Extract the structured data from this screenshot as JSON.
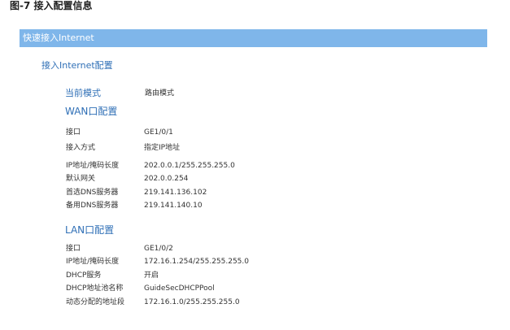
{
  "caption": "图-7 接入配置信息",
  "banner": {
    "title": "快速接入Internet"
  },
  "section": {
    "title": "接入Internet配置"
  },
  "mode": {
    "label": "当前模式",
    "value": "路由模式"
  },
  "wan": {
    "title": "WAN口配置",
    "rows": [
      {
        "label": "接口",
        "value": "GE1/0/1"
      },
      {
        "label": "接入方式",
        "value": "指定IP地址"
      },
      {
        "label": "IP地址/掩码长度",
        "value": "202.0.0.1/255.255.255.0"
      },
      {
        "label": "默认网关",
        "value": "202.0.0.254"
      },
      {
        "label": "首选DNS服务器",
        "value": "219.141.136.102"
      },
      {
        "label": "备用DNS服务器",
        "value": "219.141.140.10"
      }
    ]
  },
  "lan": {
    "title": "LAN口配置",
    "rows": [
      {
        "label": "接口",
        "value": "GE1/0/2"
      },
      {
        "label": "IP地址/掩码长度",
        "value": "172.16.1.254/255.255.255.0"
      },
      {
        "label": "DHCP服务",
        "value": "开启"
      },
      {
        "label": "DHCP地址池名称",
        "value": "GuideSecDHCPPool"
      },
      {
        "label": "动态分配的地址段",
        "value": "172.16.1.0/255.255.255.0"
      }
    ]
  }
}
